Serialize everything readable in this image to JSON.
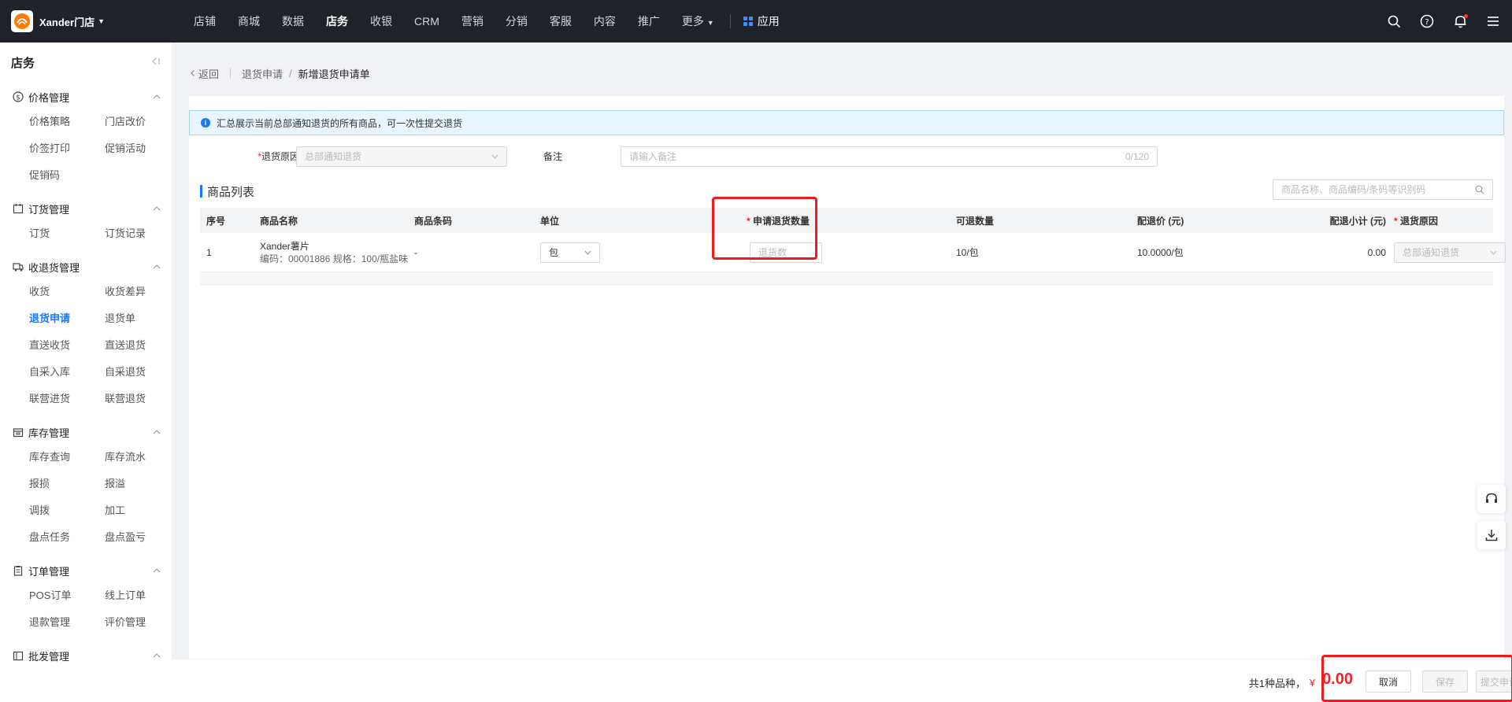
{
  "brand": {
    "name": "Xander门店"
  },
  "nav": {
    "items": [
      "店铺",
      "商城",
      "数据",
      "店务",
      "收银",
      "CRM",
      "营销",
      "分销",
      "客服",
      "内容",
      "推广"
    ],
    "more": "更多",
    "apps": "应用"
  },
  "sidebar": {
    "title": "店务",
    "groups": [
      {
        "name": "价格管理",
        "items": [
          "价格策略",
          "门店改价",
          "价签打印",
          "促销活动",
          "促销码"
        ]
      },
      {
        "name": "订货管理",
        "items": [
          "订货",
          "订货记录"
        ]
      },
      {
        "name": "收退货管理",
        "items": [
          "收货",
          "收货差异",
          "退货申请",
          "退货单",
          "直送收货",
          "直送退货",
          "自采入库",
          "自采退货",
          "联营进货",
          "联营退货"
        ]
      },
      {
        "name": "库存管理",
        "items": [
          "库存查询",
          "库存流水",
          "报损",
          "报溢",
          "调拨",
          "加工",
          "盘点任务",
          "盘点盈亏"
        ]
      },
      {
        "name": "订单管理",
        "items": [
          "POS订单",
          "线上订单",
          "退款管理",
          "评价管理"
        ]
      },
      {
        "name": "批发管理",
        "items": []
      }
    ]
  },
  "breadcrumb": {
    "back": "返回",
    "parent": "退货申请",
    "slash": "/",
    "current": "新增退货申请单"
  },
  "alert": {
    "text": "汇总展示当前总部通知退货的所有商品，可一次性提交退货"
  },
  "form": {
    "reason_label": "退货原因",
    "reason_required": "*",
    "reason_value": "总部通知退货",
    "remark_label": "备注",
    "remark_placeholder": "请输入备注",
    "remark_counter": "0/120"
  },
  "product_list": {
    "title": "商品列表",
    "search_placeholder": "商品名称、商品编码/条码等识别码",
    "columns": {
      "index": "序号",
      "name": "商品名称",
      "barcode": "商品条码",
      "unit": "单位",
      "qty": "申请退货数量",
      "available": "可退数量",
      "price": "配退价 (元)",
      "subtotal": "配退小计 (元)",
      "reason": "退货原因",
      "required": "*"
    },
    "rows": [
      {
        "index": "1",
        "name": "Xander薯片",
        "meta": "编码：00001886  规格：100/瓶盐味",
        "barcode": "-",
        "unit": "包",
        "qty_placeholder": "退货数",
        "available": "10/包",
        "price": "10.0000/包",
        "subtotal": "0.00",
        "reason": "总部通知退货"
      }
    ]
  },
  "footer": {
    "total_label": "共1种品种，",
    "currency": "¥",
    "amount": "0.00",
    "cancel": "取消",
    "save": "保存",
    "submit": "提交申请"
  },
  "colors": {
    "accent": "#1677ff",
    "danger": "#f5222d",
    "topbar": "#1f2228",
    "highlight": "#ee1c1c"
  }
}
